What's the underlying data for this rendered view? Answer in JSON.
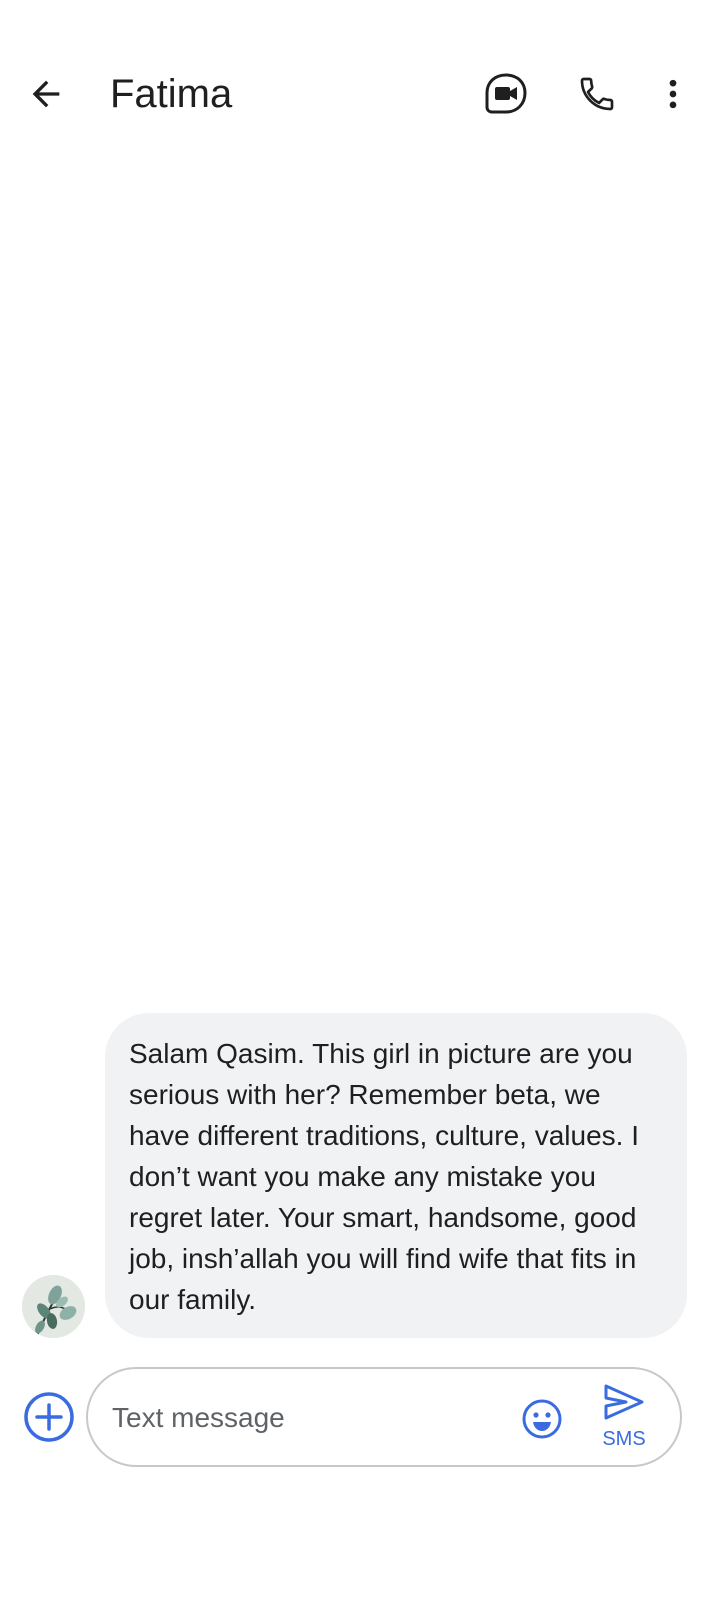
{
  "header": {
    "contact_name": "Fatima",
    "icons": {
      "back": "arrow-back-icon",
      "video": "video-call-icon",
      "call": "phone-icon",
      "more": "more-vert-icon"
    }
  },
  "conversation": {
    "messages": [
      {
        "direction": "incoming",
        "text": "Salam Qasim. This girl in picture are you serious with her? Remember beta, we have different traditions, culture, values. I don’t want you make any mistake you regret later. Your smart, handsome, good job, insh’allah you will find wife that fits in our family.",
        "avatar": "contact-avatar"
      }
    ]
  },
  "compose": {
    "placeholder": "Text message",
    "value": "",
    "send_label": "SMS",
    "icons": {
      "add": "add-circle-icon",
      "emoji": "emoji-icon",
      "send": "send-icon"
    }
  },
  "colors": {
    "accent": "#3a6be0",
    "bubble_incoming": "#f1f2f4",
    "compose_border": "#c6c8cc",
    "text_primary": "#1f1f1f",
    "text_placeholder": "#5f6368"
  }
}
